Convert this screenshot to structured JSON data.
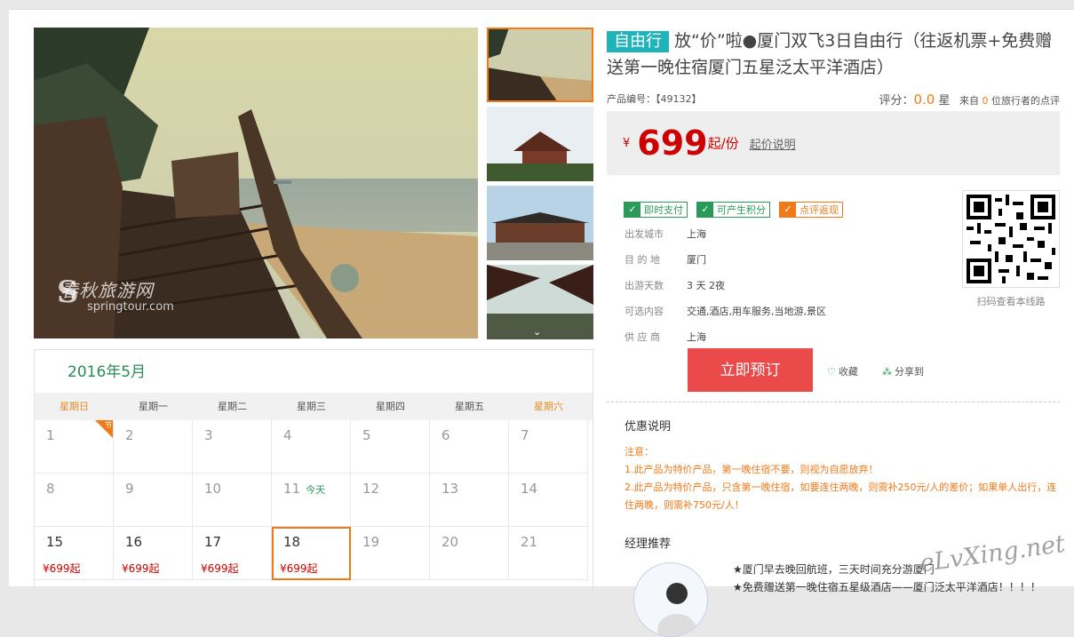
{
  "gallery": {
    "watermark_cn": "春秋旅游网",
    "watermark_en": "springtour.com"
  },
  "product": {
    "tag": "自由行",
    "title": "放“价”啦●厦门双飞3日自由行（往返机票+免费赠送第一晚住宿厦门五星泛太平洋酒店）",
    "code_label": "产品编号：【49132】",
    "score_label": "评分：",
    "score_value": "0.0",
    "score_unit": "星",
    "reviews_prefix": "来自",
    "reviews_count": "0",
    "reviews_suffix": "位旅行者的点评",
    "price_currency": "¥",
    "price_value": "699",
    "price_unit": "起/份",
    "price_explain": "起价说明"
  },
  "badges": [
    "即时支付",
    "可产生积分",
    "点评返现"
  ],
  "fields": [
    {
      "label": "出发城市",
      "value": "上海"
    },
    {
      "label": "目 的 地",
      "value": "厦门"
    },
    {
      "label": "出游天数",
      "value": "3 天 2夜"
    },
    {
      "label": "可选内容",
      "value": "交通,酒店,用车服务,当地游,景区"
    },
    {
      "label": "供 应 商",
      "value": "上海"
    }
  ],
  "qr": {
    "caption": "扫码查看本线路"
  },
  "actions": {
    "book": "立即预订",
    "favorite": "收藏",
    "share": "分享到"
  },
  "promo": {
    "heading": "优惠说明",
    "lines": [
      "注意：",
      "1.此产品为特价产品，第一晚住宿不要，则视为自愿放弃！",
      "2.此产品为特价产品，只含第一晚住宿，如要连住两晚，则需补250元/人的差价；如果单人出行，连住两晚，则需补750元/人！"
    ]
  },
  "manager": {
    "heading": "经理推荐",
    "text": "★厦门早去晚回航班，三天时间充分游厦门",
    "text2": "★免费赠送第一晚住宿五星级酒店——厦门泛太平洋酒店！！！！"
  },
  "site_mark": "eLvXing.net",
  "calendar": {
    "title": "2016年5月",
    "weekdays": [
      "星期日",
      "星期一",
      "星期二",
      "星期三",
      "星期四",
      "星期五",
      "星期六"
    ],
    "holiday_mark": "节",
    "today_label": "今天",
    "days": [
      {
        "n": "1",
        "price": ""
      },
      {
        "n": "2",
        "price": ""
      },
      {
        "n": "3",
        "price": ""
      },
      {
        "n": "4",
        "price": ""
      },
      {
        "n": "5",
        "price": ""
      },
      {
        "n": "6",
        "price": ""
      },
      {
        "n": "7",
        "price": ""
      },
      {
        "n": "8",
        "price": ""
      },
      {
        "n": "9",
        "price": ""
      },
      {
        "n": "10",
        "price": ""
      },
      {
        "n": "11",
        "price": ""
      },
      {
        "n": "12",
        "price": ""
      },
      {
        "n": "13",
        "price": ""
      },
      {
        "n": "14",
        "price": ""
      },
      {
        "n": "15",
        "price": "¥699起"
      },
      {
        "n": "16",
        "price": "¥699起"
      },
      {
        "n": "17",
        "price": "¥699起"
      },
      {
        "n": "18",
        "price": "¥699起"
      },
      {
        "n": "19",
        "price": ""
      },
      {
        "n": "20",
        "price": ""
      },
      {
        "n": "21",
        "price": ""
      }
    ]
  }
}
